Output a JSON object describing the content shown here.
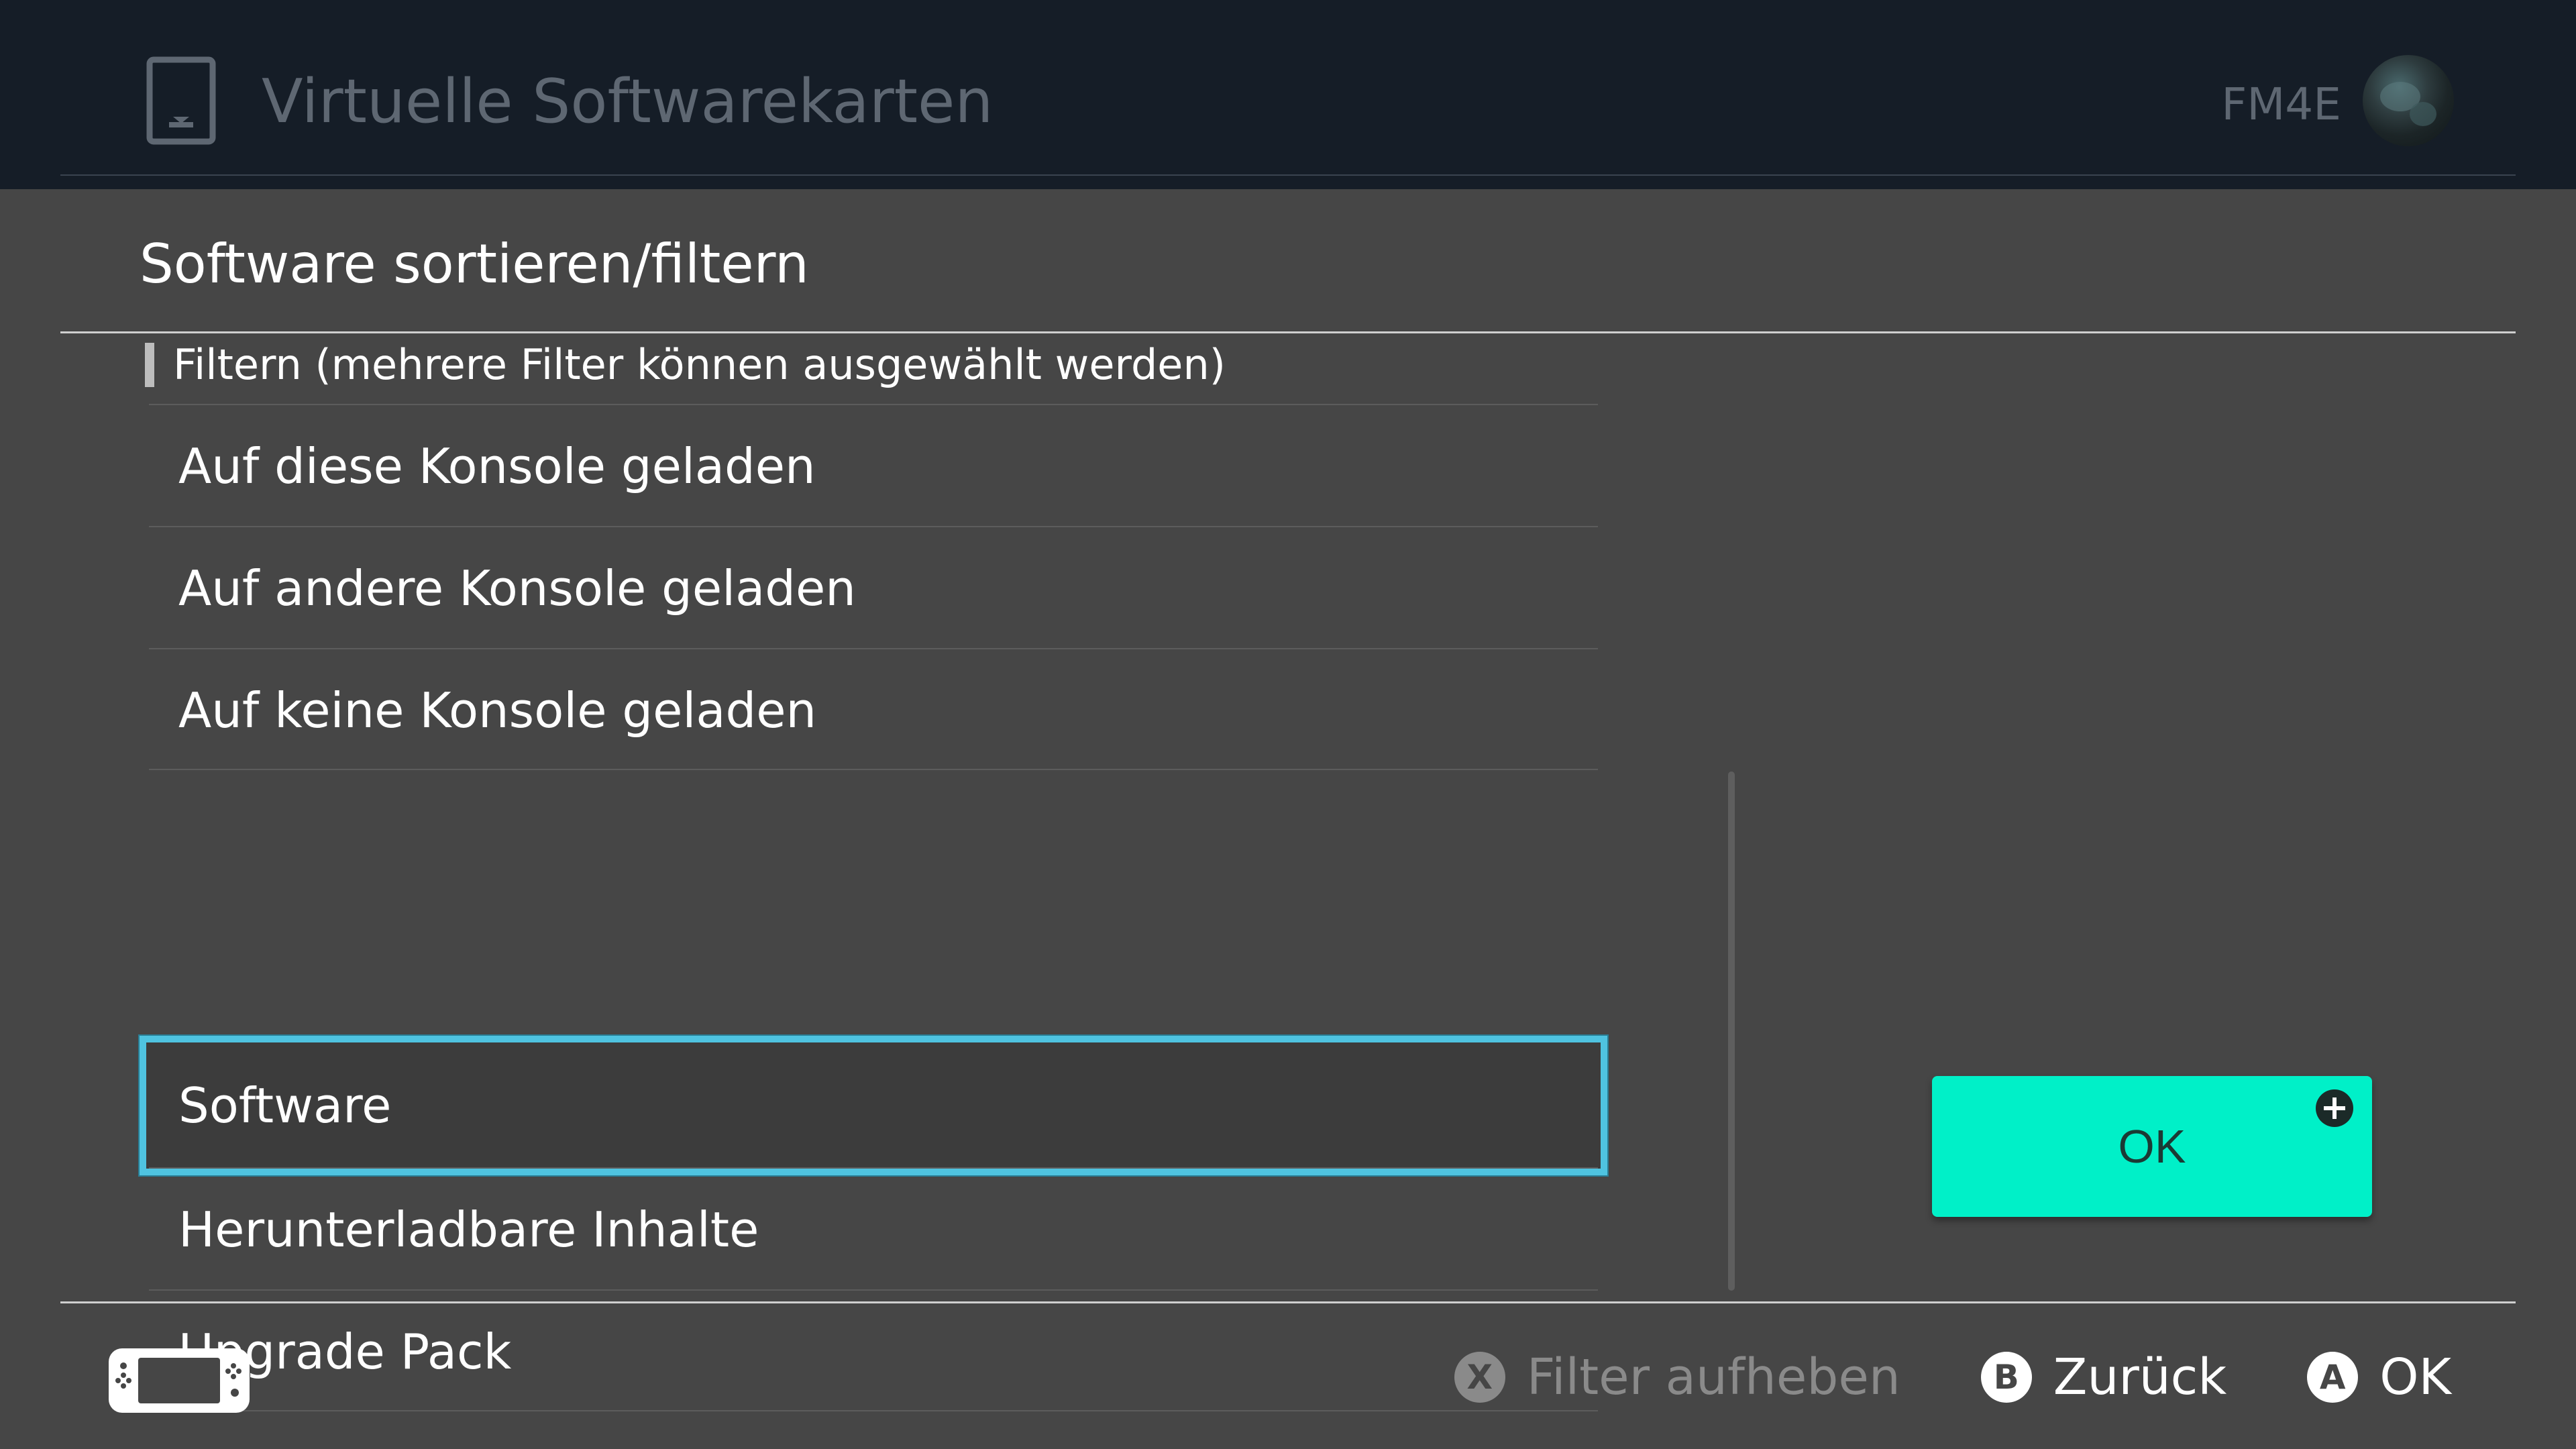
{
  "background_header": {
    "title": "Virtuelle Softwarekarten",
    "user_code": "FM4E",
    "icon": "virtual-card-icon",
    "avatar": "user-avatar"
  },
  "dialog": {
    "title": "Software sortieren/filtern",
    "section_header": "Filtern (mehrere Filter können ausgewählt werden)",
    "group_console": [
      {
        "label": "Auf diese Konsole geladen"
      },
      {
        "label": "Auf andere Konsole geladen"
      },
      {
        "label": "Auf keine Konsole geladen"
      }
    ],
    "group_type": [
      {
        "label": "Software",
        "selected": true
      },
      {
        "label": "Herunterladbare Inhalte"
      },
      {
        "label": "Upgrade Pack"
      }
    ],
    "ok_button": {
      "label": "OK",
      "icon": "plus-icon"
    }
  },
  "footer": {
    "console_icon": "handheld-console-icon",
    "actions": [
      {
        "glyph": "X",
        "label": "Filter aufheben",
        "disabled": true
      },
      {
        "glyph": "B",
        "label": "Zurück",
        "disabled": false
      },
      {
        "glyph": "A",
        "label": "OK",
        "disabled": false
      }
    ]
  },
  "colors": {
    "panel_background": "#464646",
    "header_background": "#151d27",
    "selection_border": "#4fc3e0",
    "ok_button": "#00f0c8"
  }
}
